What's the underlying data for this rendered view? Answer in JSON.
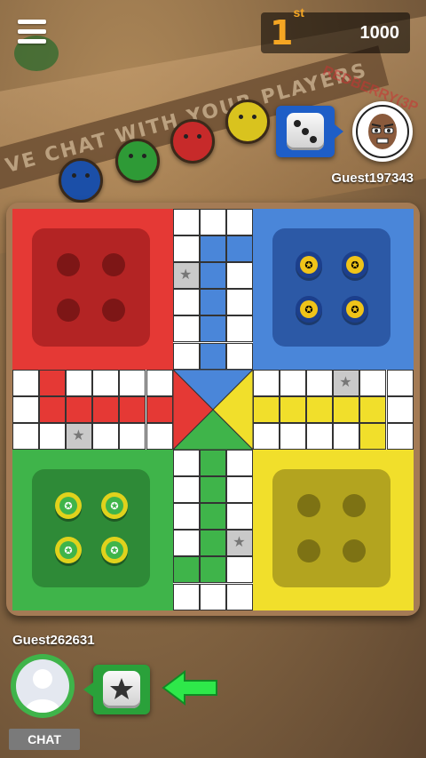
{
  "background": {
    "banner_text": "VE CHAT WITH YOUR PLAYERS",
    "side_text": "REDBERRY(3P"
  },
  "header": {
    "menu_icon": "hamburger-menu-icon",
    "rank": "1",
    "rank_suffix": "st",
    "score": "1000"
  },
  "opponent": {
    "name": "Guest197343",
    "dice_value": 3,
    "color": "#1e5ec7"
  },
  "board": {
    "colors": {
      "red": "#e53935",
      "blue": "#4a86d9",
      "green": "#3fb44a",
      "yellow": "#f1df2b",
      "red_home": "#b32424",
      "blue_home": "#2c59a6",
      "green_home": "#2e8a37",
      "yellow_home": "#b3a41f"
    },
    "tokens_in_home": {
      "blue": 4,
      "green": 4,
      "red": 0,
      "yellow": 0
    }
  },
  "player": {
    "name": "Guest262631",
    "chat_label": "CHAT",
    "dice_icon": "star-dice-icon",
    "color": "#2aa13a"
  }
}
